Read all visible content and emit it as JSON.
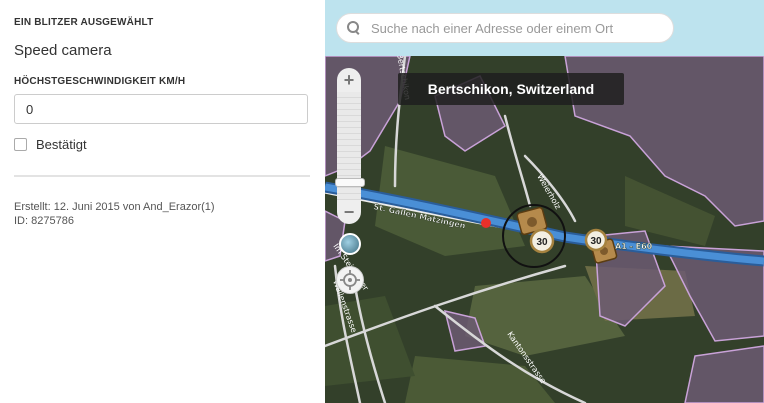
{
  "panel": {
    "section_title": "EIN BLITZER AUSGEWÄHLT",
    "camera_type": "Speed camera",
    "speed_label": "HÖCHSTGESCHWINDIGKEIT KM/H",
    "speed_value": "0",
    "confirmed_label": "Bestätigt",
    "confirmed": false,
    "created_text": "Erstellt: 12. Juni 2015 von And_Erazor(1)",
    "id_text": "ID: 8275786"
  },
  "map": {
    "search_placeholder": "Suche nach einer Adresse oder einem Ort",
    "location_name": "Bertschikon, Switzerland",
    "road_main": "St. Gallen Matzingen",
    "road_highway": "A1 - E60",
    "road_weierholz": "Weierholz",
    "road_kantonsstrasse": "Kantonsstrasse",
    "road_im_steinacker": "Im Steinacker",
    "road_wallenstrasse": "Wallenstrasse",
    "road_bertschikon": "Bertschikon",
    "camera_speed_1": "30",
    "camera_speed_2": "30",
    "zoom_plus": "+",
    "zoom_minus": "−",
    "zoom_level_fraction": 0.87,
    "icons": [
      "search-icon",
      "layer-icon",
      "crosshair-icon"
    ],
    "colors": {
      "highway": "#4a8fd6",
      "area_outline": "#c9a2d8",
      "area_fill": "#6c5a72",
      "selected_point": "#e8302a"
    }
  }
}
